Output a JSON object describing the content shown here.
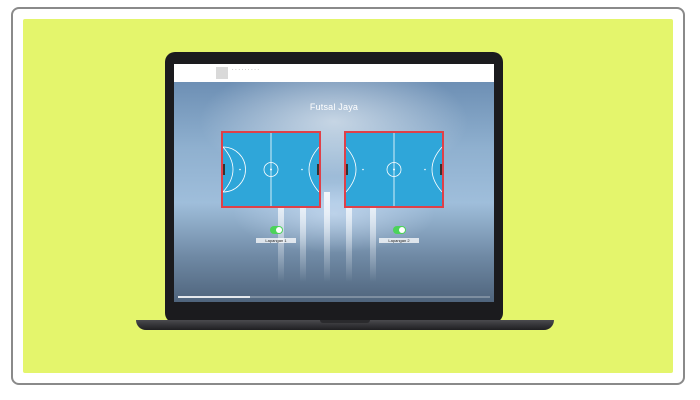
{
  "app": {
    "page_title": "Futsal Jaya",
    "accent_color": "#e4f56c",
    "court_color": "#2fa6d9",
    "court_border_color": "#e04048"
  },
  "browser": {
    "url_text": "· · · · · · · · ·"
  },
  "courts": [
    {
      "label": "Lapangan 1"
    },
    {
      "label": "Lapangan 2"
    }
  ],
  "toggles": [
    {
      "label": "Lapangan 1",
      "state": "on"
    },
    {
      "label": "Lapangan 2",
      "state": "on"
    }
  ],
  "media": {
    "progress": 0.23
  }
}
